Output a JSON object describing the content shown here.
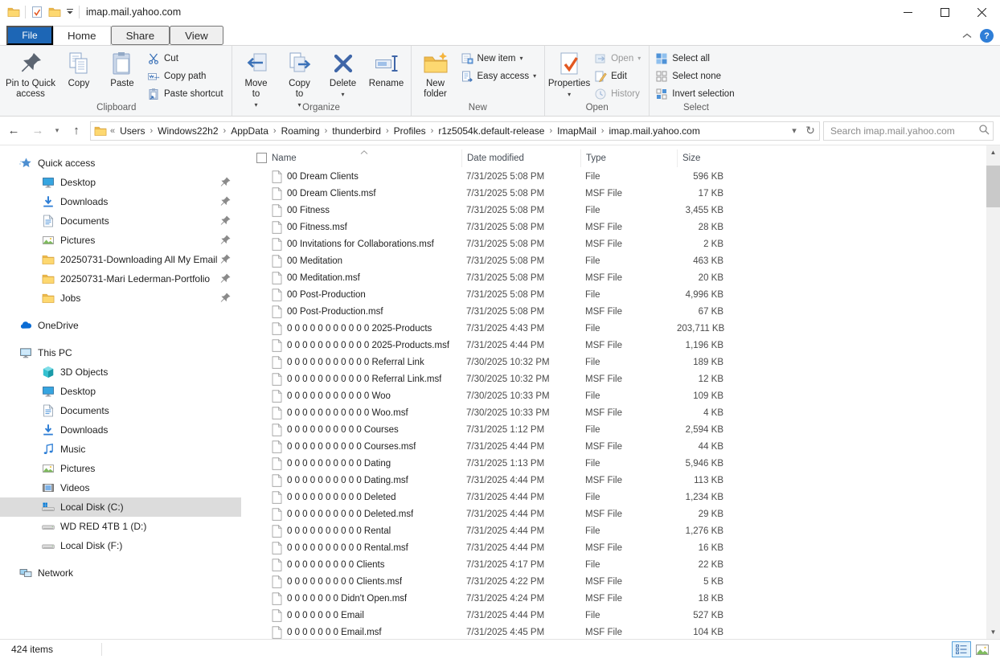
{
  "window": {
    "title": "imap.mail.yahoo.com",
    "qat_icons": [
      "folder",
      "properties-check",
      "folder",
      "qat-dropdown"
    ],
    "controls": {
      "minimize": "minimize",
      "maximize": "maximize",
      "close": "close"
    }
  },
  "tabs": {
    "file_label": "File",
    "items": [
      {
        "label": "Home",
        "active": true
      },
      {
        "label": "Share",
        "active": false
      },
      {
        "label": "View",
        "active": false
      }
    ],
    "help_label": "?"
  },
  "ribbon": {
    "groups": [
      {
        "label": "Clipboard",
        "big": [
          {
            "label": "Pin to Quick access",
            "icon": "pin",
            "wide": true
          },
          {
            "label": "Copy",
            "icon": "copy"
          },
          {
            "label": "Paste",
            "icon": "paste"
          }
        ],
        "small": [
          {
            "label": "Cut",
            "icon": "cut"
          },
          {
            "label": "Copy path",
            "icon": "copy-path"
          },
          {
            "label": "Paste shortcut",
            "icon": "paste-shortcut"
          }
        ]
      },
      {
        "label": "Organize",
        "big": [
          {
            "label": "Move\nto",
            "icon": "move-to",
            "drop": true
          },
          {
            "label": "Copy\nto",
            "icon": "copy-to",
            "drop": true
          },
          {
            "label": "Delete",
            "icon": "delete",
            "drop": true
          },
          {
            "label": "Rename",
            "icon": "rename"
          }
        ],
        "small": []
      },
      {
        "label": "New",
        "big": [
          {
            "label": "New\nfolder",
            "icon": "new-folder"
          }
        ],
        "small": [
          {
            "label": "New item",
            "icon": "new-item",
            "drop": true
          },
          {
            "label": "Easy access",
            "icon": "easy-access",
            "drop": true
          }
        ]
      },
      {
        "label": "Open",
        "big": [
          {
            "label": "Properties",
            "icon": "properties",
            "drop": true
          }
        ],
        "small": [
          {
            "label": "Open",
            "icon": "open",
            "drop": true,
            "disabled": true
          },
          {
            "label": "Edit",
            "icon": "edit"
          },
          {
            "label": "History",
            "icon": "history",
            "disabled": true
          }
        ]
      },
      {
        "label": "Select",
        "big": [],
        "small": [
          {
            "label": "Select all",
            "icon": "select-all"
          },
          {
            "label": "Select none",
            "icon": "select-none"
          },
          {
            "label": "Invert selection",
            "icon": "invert-selection"
          }
        ]
      }
    ]
  },
  "navbar": {
    "breadcrumb_prefix": "«",
    "breadcrumb": [
      "Users",
      "Windows22h2",
      "AppData",
      "Roaming",
      "thunderbird",
      "Profiles",
      "r1z5054k.default-release",
      "ImapMail",
      "imap.mail.yahoo.com"
    ],
    "search_placeholder": "Search imap.mail.yahoo.com"
  },
  "sidebar": {
    "sections": [
      {
        "label": "Quick access",
        "icon": "quick-access",
        "children": [
          {
            "label": "Desktop",
            "icon": "desktop",
            "pinned": true
          },
          {
            "label": "Downloads",
            "icon": "downloads",
            "pinned": true
          },
          {
            "label": "Documents",
            "icon": "documents",
            "pinned": true
          },
          {
            "label": "Pictures",
            "icon": "pictures",
            "pinned": true
          },
          {
            "label": "20250731-Downloading All My Email",
            "icon": "folder",
            "pinned": true
          },
          {
            "label": "20250731-Mari Lederman-Portfolio",
            "icon": "folder",
            "pinned": true
          },
          {
            "label": "Jobs",
            "icon": "folder",
            "pinned": true
          }
        ]
      },
      {
        "label": "OneDrive",
        "icon": "onedrive",
        "children": []
      },
      {
        "label": "This PC",
        "icon": "this-pc",
        "children": [
          {
            "label": "3D Objects",
            "icon": "objects-3d"
          },
          {
            "label": "Desktop",
            "icon": "desktop"
          },
          {
            "label": "Documents",
            "icon": "documents"
          },
          {
            "label": "Downloads",
            "icon": "downloads"
          },
          {
            "label": "Music",
            "icon": "music"
          },
          {
            "label": "Pictures",
            "icon": "pictures"
          },
          {
            "label": "Videos",
            "icon": "videos"
          },
          {
            "label": "Local Disk (C:)",
            "icon": "disk-os",
            "selected": true
          },
          {
            "label": "WD RED 4TB 1 (D:)",
            "icon": "disk"
          },
          {
            "label": "Local Disk (F:)",
            "icon": "disk"
          }
        ]
      },
      {
        "label": "Network",
        "icon": "network",
        "children": []
      }
    ]
  },
  "list": {
    "columns": [
      "Name",
      "Date modified",
      "Type",
      "Size"
    ],
    "sort_column": "Name",
    "sort_ascending": true,
    "rows": [
      {
        "name": "00 Dream Clients",
        "date": "7/31/2025 5:08 PM",
        "type": "File",
        "size": "596 KB"
      },
      {
        "name": "00 Dream Clients.msf",
        "date": "7/31/2025 5:08 PM",
        "type": "MSF File",
        "size": "17 KB"
      },
      {
        "name": "00 Fitness",
        "date": "7/31/2025 5:08 PM",
        "type": "File",
        "size": "3,455 KB"
      },
      {
        "name": "00 Fitness.msf",
        "date": "7/31/2025 5:08 PM",
        "type": "MSF File",
        "size": "28 KB"
      },
      {
        "name": "00 Invitations for Collaborations.msf",
        "date": "7/31/2025 5:08 PM",
        "type": "MSF File",
        "size": "2 KB"
      },
      {
        "name": "00 Meditation",
        "date": "7/31/2025 5:08 PM",
        "type": "File",
        "size": "463 KB"
      },
      {
        "name": "00 Meditation.msf",
        "date": "7/31/2025 5:08 PM",
        "type": "MSF File",
        "size": "20 KB"
      },
      {
        "name": "00 Post-Production",
        "date": "7/31/2025 5:08 PM",
        "type": "File",
        "size": "4,996 KB"
      },
      {
        "name": "00 Post-Production.msf",
        "date": "7/31/2025 5:08 PM",
        "type": "MSF File",
        "size": "67 KB"
      },
      {
        "name": "0 0 0 0 0 0 0 0 0 0 0 2025-Products",
        "date": "7/31/2025 4:43 PM",
        "type": "File",
        "size": "203,711 KB"
      },
      {
        "name": "0 0 0 0 0 0 0 0 0 0 0 2025-Products.msf",
        "date": "7/31/2025 4:44 PM",
        "type": "MSF File",
        "size": "1,196 KB"
      },
      {
        "name": "0 0 0 0 0 0 0 0 0 0 0 Referral Link",
        "date": "7/30/2025 10:32 PM",
        "type": "File",
        "size": "189 KB"
      },
      {
        "name": "0 0 0 0 0 0 0 0 0 0 0 Referral Link.msf",
        "date": "7/30/2025 10:32 PM",
        "type": "MSF File",
        "size": "12 KB"
      },
      {
        "name": "0 0 0 0 0 0 0 0 0 0 0 Woo",
        "date": "7/30/2025 10:33 PM",
        "type": "File",
        "size": "109 KB"
      },
      {
        "name": "0 0 0 0 0 0 0 0 0 0 0 Woo.msf",
        "date": "7/30/2025 10:33 PM",
        "type": "MSF File",
        "size": "4 KB"
      },
      {
        "name": "0 0 0 0 0 0 0 0 0 0 Courses",
        "date": "7/31/2025 1:12 PM",
        "type": "File",
        "size": "2,594 KB"
      },
      {
        "name": "0 0 0 0 0 0 0 0 0 0 Courses.msf",
        "date": "7/31/2025 4:44 PM",
        "type": "MSF File",
        "size": "44 KB"
      },
      {
        "name": "0 0 0 0 0 0 0 0 0 0 Dating",
        "date": "7/31/2025 1:13 PM",
        "type": "File",
        "size": "5,946 KB"
      },
      {
        "name": "0 0 0 0 0 0 0 0 0 0 Dating.msf",
        "date": "7/31/2025 4:44 PM",
        "type": "MSF File",
        "size": "113 KB"
      },
      {
        "name": "0 0 0 0 0 0 0 0 0 0 Deleted",
        "date": "7/31/2025 4:44 PM",
        "type": "File",
        "size": "1,234 KB"
      },
      {
        "name": "0 0 0 0 0 0 0 0 0 0 Deleted.msf",
        "date": "7/31/2025 4:44 PM",
        "type": "MSF File",
        "size": "29 KB"
      },
      {
        "name": "0 0 0 0 0 0 0 0 0 0 Rental",
        "date": "7/31/2025 4:44 PM",
        "type": "File",
        "size": "1,276 KB"
      },
      {
        "name": "0 0 0 0 0 0 0 0 0 0 Rental.msf",
        "date": "7/31/2025 4:44 PM",
        "type": "MSF File",
        "size": "16 KB"
      },
      {
        "name": "0 0 0 0 0 0 0 0 0 Clients",
        "date": "7/31/2025 4:17 PM",
        "type": "File",
        "size": "22 KB"
      },
      {
        "name": "0 0 0 0 0 0 0 0 0 Clients.msf",
        "date": "7/31/2025 4:22 PM",
        "type": "MSF File",
        "size": "5 KB"
      },
      {
        "name": "0 0 0 0 0 0 0 Didn't Open.msf",
        "date": "7/31/2025 4:24 PM",
        "type": "MSF File",
        "size": "18 KB"
      },
      {
        "name": "0 0 0 0 0 0 0 Email",
        "date": "7/31/2025 4:44 PM",
        "type": "File",
        "size": "527 KB"
      },
      {
        "name": "0 0 0 0 0 0 0 Email.msf",
        "date": "7/31/2025 4:45 PM",
        "type": "MSF File",
        "size": "104 KB"
      }
    ]
  },
  "status": {
    "items_text": "424 items",
    "view_buttons": [
      {
        "name": "details-view",
        "active": true
      },
      {
        "name": "thumbnail-view",
        "active": false
      }
    ]
  },
  "colors": {
    "file_tab_blue": "#1d66b5",
    "help_blue": "#2f7ed7",
    "ribbon_bg": "#f5f6f7",
    "sidebar_selection": "#dcdcdc",
    "folder_yellow": "#fdd870",
    "ribbon_icon_blue": "#3c72b8",
    "properties_check_orange": "#e25822",
    "view_toggle_border": "#5aa3dc"
  }
}
